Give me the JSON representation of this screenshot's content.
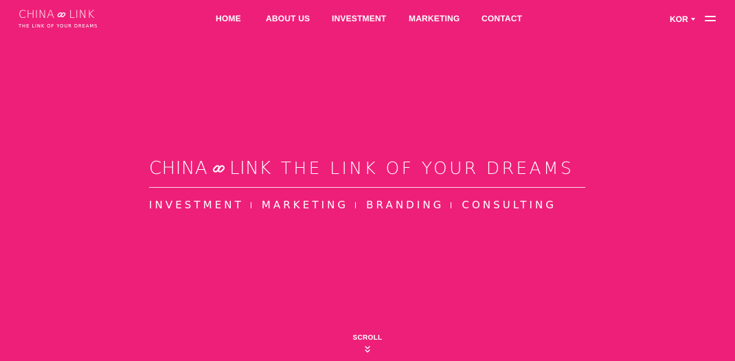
{
  "brand": {
    "name_left": "CHINA",
    "name_right": "LINK",
    "tagline": "THE LINK OF YOUR DREAMS",
    "icon": "chain-link-icon"
  },
  "nav": {
    "items": [
      {
        "label": "HOME"
      },
      {
        "label": "ABOUT US"
      },
      {
        "label": "INVESTMENT"
      },
      {
        "label": "MARKETING"
      },
      {
        "label": "CONTACT"
      }
    ]
  },
  "language": {
    "selected": "KOR",
    "icon": "caret-down-icon"
  },
  "menu": {
    "icon": "hamburger-menu-icon"
  },
  "hero": {
    "brand_left": "CHINA",
    "brand_right": "LINK",
    "slogan": "THE LINK OF YOUR DREAMS",
    "services": [
      "INVESTMENT",
      "MARKETING",
      "BRANDING",
      "CONSULTING"
    ]
  },
  "scroll": {
    "label": "SCROLL",
    "icon": "double-chevron-down-icon"
  },
  "colors": {
    "background": "#EE1F79",
    "foreground": "#FFFFFF"
  }
}
